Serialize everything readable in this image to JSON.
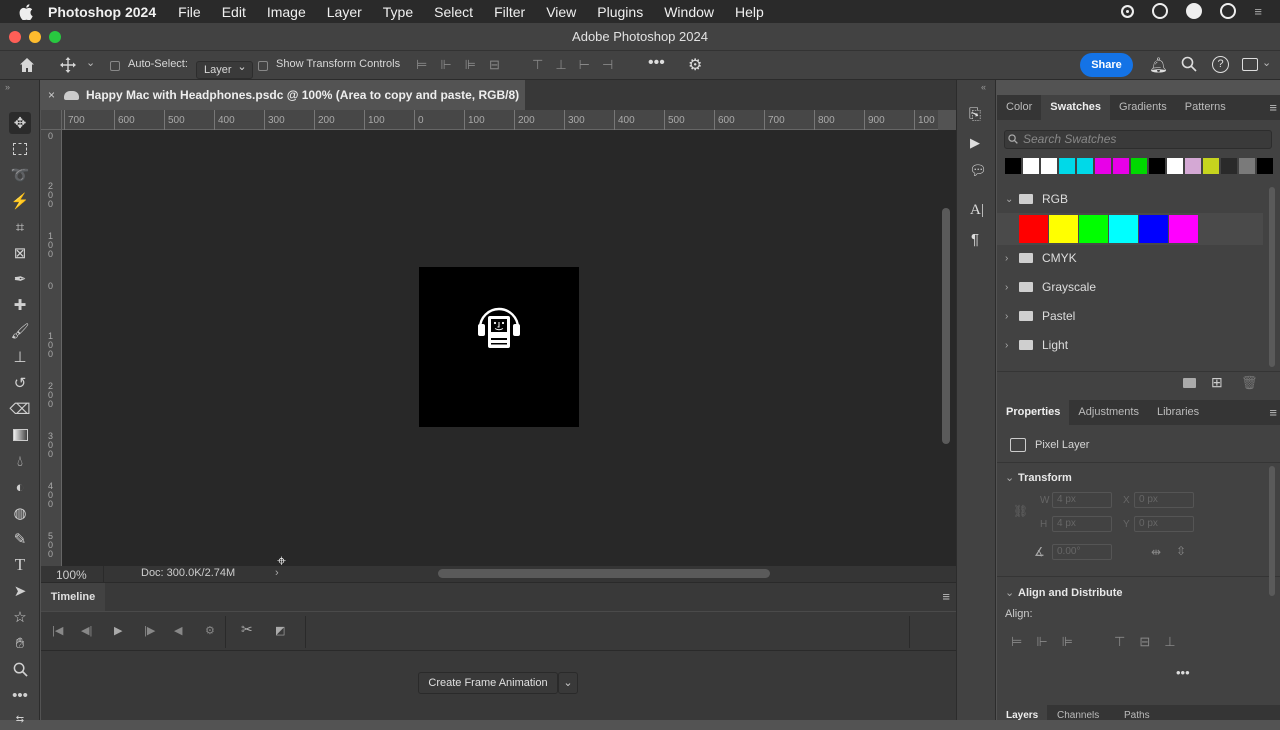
{
  "menubar": {
    "app_name": "Photoshop 2024",
    "items": [
      "File",
      "Edit",
      "Image",
      "Layer",
      "Type",
      "Select",
      "Filter",
      "View",
      "Plugins",
      "Window",
      "Help"
    ]
  },
  "window": {
    "title": "Adobe Photoshop 2024"
  },
  "options": {
    "auto_select_label": "Auto-Select:",
    "auto_select_value": "Layer",
    "show_transform_label": "Show Transform Controls",
    "share_label": "Share"
  },
  "document": {
    "tab_title": "Happy Mac with Headphones.psdc @ 100% (Area to copy and paste, RGB/8)",
    "zoom": "100%",
    "doc_info": "Doc: 300.0K/2.74M",
    "ruler_h": [
      "700",
      "600",
      "500",
      "400",
      "300",
      "200",
      "100",
      "0",
      "100",
      "200",
      "300",
      "400",
      "500",
      "600",
      "700",
      "800",
      "900",
      "100"
    ],
    "ruler_v": [
      "0",
      "2\n0\n0",
      "1\n0\n0",
      "0",
      "1\n0\n0",
      "2\n0\n0",
      "3\n0\n0",
      "4\n0\n0",
      "5\n0\n0"
    ]
  },
  "timeline": {
    "tab_label": "Timeline",
    "create_label": "Create Frame Animation"
  },
  "swatches_panel": {
    "tabs": [
      "Color",
      "Swatches",
      "Gradients",
      "Patterns"
    ],
    "active_tab": "Swatches",
    "search_placeholder": "Search Swatches",
    "recent_colors": [
      "#000000",
      "#ffffff",
      "#ffffff",
      "#00d9e8",
      "#00d9e8",
      "#e800e8",
      "#e800e8",
      "#00d800",
      "#000000",
      "#ffffff",
      "#d4a8d4",
      "#c6d41e",
      "#2a2a2a",
      "#7a7a7a",
      "#000000"
    ],
    "groups": [
      {
        "name": "RGB",
        "expanded": true,
        "colors": [
          "#ff0000",
          "#ffff00",
          "#00ff00",
          "#00ffff",
          "#0000ff",
          "#ff00ff"
        ]
      },
      {
        "name": "CMYK",
        "expanded": false
      },
      {
        "name": "Grayscale",
        "expanded": false
      },
      {
        "name": "Pastel",
        "expanded": false
      },
      {
        "name": "Light",
        "expanded": false
      }
    ]
  },
  "properties_panel": {
    "tabs": [
      "Properties",
      "Adjustments",
      "Libraries"
    ],
    "active_tab": "Properties",
    "layer_type": "Pixel Layer",
    "transform_label": "Transform",
    "w_label": "W",
    "w_value": "4 px",
    "h_label": "H",
    "h_value": "4 px",
    "x_label": "X",
    "x_value": "0 px",
    "y_label": "Y",
    "y_value": "0 px",
    "angle_value": "0.00°",
    "align_distribute_label": "Align and Distribute",
    "align_label": "Align:"
  },
  "layers_tabs": [
    "Layers",
    "Channels",
    "Paths"
  ]
}
